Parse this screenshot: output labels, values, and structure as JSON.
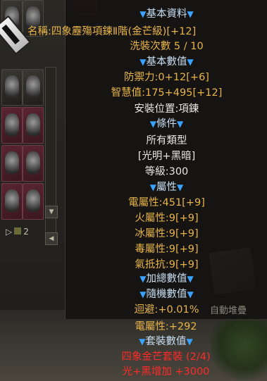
{
  "tooltip": {
    "section_basic": "基本資料",
    "item_name": "名稱:四象靂殤項鍊Ⅱ階(金芒級)[+12]",
    "wash_count": "洗裝次數 5 / 10",
    "section_base_values": "基本數值",
    "defense": "防禦力:0+12[+6]",
    "wisdom": "智慧值:175+495[+12]",
    "equip_position": "安裝位置:項鍊",
    "section_conditions": "條件",
    "all_types": "所有類型",
    "alignment": "[光明+黑暗]",
    "level": "等級:300",
    "section_attributes": "屬性",
    "electric": "電屬性:451[+9]",
    "fire": "火屬性:9[+9]",
    "ice": "冰屬性:9[+9]",
    "poison": "毒屬性:9[+9]",
    "qi_resist": "氣抵抗:9[+9]",
    "section_bonus": "加總數值",
    "section_random": "隨機數值",
    "dodge": "迴避:+0.01%",
    "electric_bonus": "電屬性:+292",
    "section_set": "套裝數值",
    "set_name": "四象金芒套裝 (2/4)",
    "set_bonus": "光+黑增加 +3000"
  },
  "inventory": {
    "auto_stack_label": "自動堆疊",
    "page_indicator": "2"
  },
  "icons": {
    "header_marker": "blue-triangle",
    "cursor": "game-cursor-icon"
  },
  "colors": {
    "header_text": "#c9dff4",
    "stat_gold": "#e8b448",
    "plain_white": "#e6e6e6",
    "set_red": "#ff2a2a",
    "triangle_blue": "#3aa2ff"
  }
}
